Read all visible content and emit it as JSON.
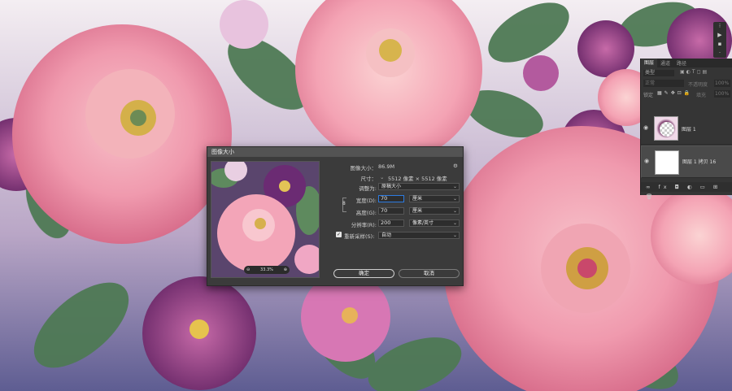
{
  "dialog": {
    "title": "图像大小",
    "image_size_label": "图像大小：",
    "image_size_value": "86.9M",
    "dimensions_label": "尺寸：",
    "dimensions_value": "5512 像素 × 5512 像素",
    "fit_label": "调整为:",
    "fit_value": "原稿大小",
    "width_label": "宽度(D):",
    "width_value": "70",
    "width_unit": "厘米",
    "height_label": "高度(G):",
    "height_value": "70",
    "height_unit": "厘米",
    "resolution_label": "分辨率(R):",
    "resolution_value": "200",
    "resolution_unit": "像素/英寸",
    "resample_label": "重新采样(S):",
    "resample_value": "自动",
    "resample_checked": true,
    "zoom": "33.3%",
    "ok_label": "确定",
    "cancel_label": "取消"
  },
  "layers_panel": {
    "tabs": [
      "图层",
      "通道",
      "路径"
    ],
    "search_placeholder": "类型",
    "blend_mode": "正常",
    "opacity_label": "不透明度",
    "opacity_value": "100%",
    "lock_label": "锁定",
    "fill_label": "填充",
    "fill_value": "100%",
    "layers": [
      {
        "name": "图层 1",
        "selected": false
      },
      {
        "name": "图层 1 拷贝 16",
        "selected": true
      }
    ]
  },
  "colors": {
    "accent": "#2d7be0",
    "dialog_bg": "#3b3b3b",
    "panel_bg": "#353535"
  }
}
